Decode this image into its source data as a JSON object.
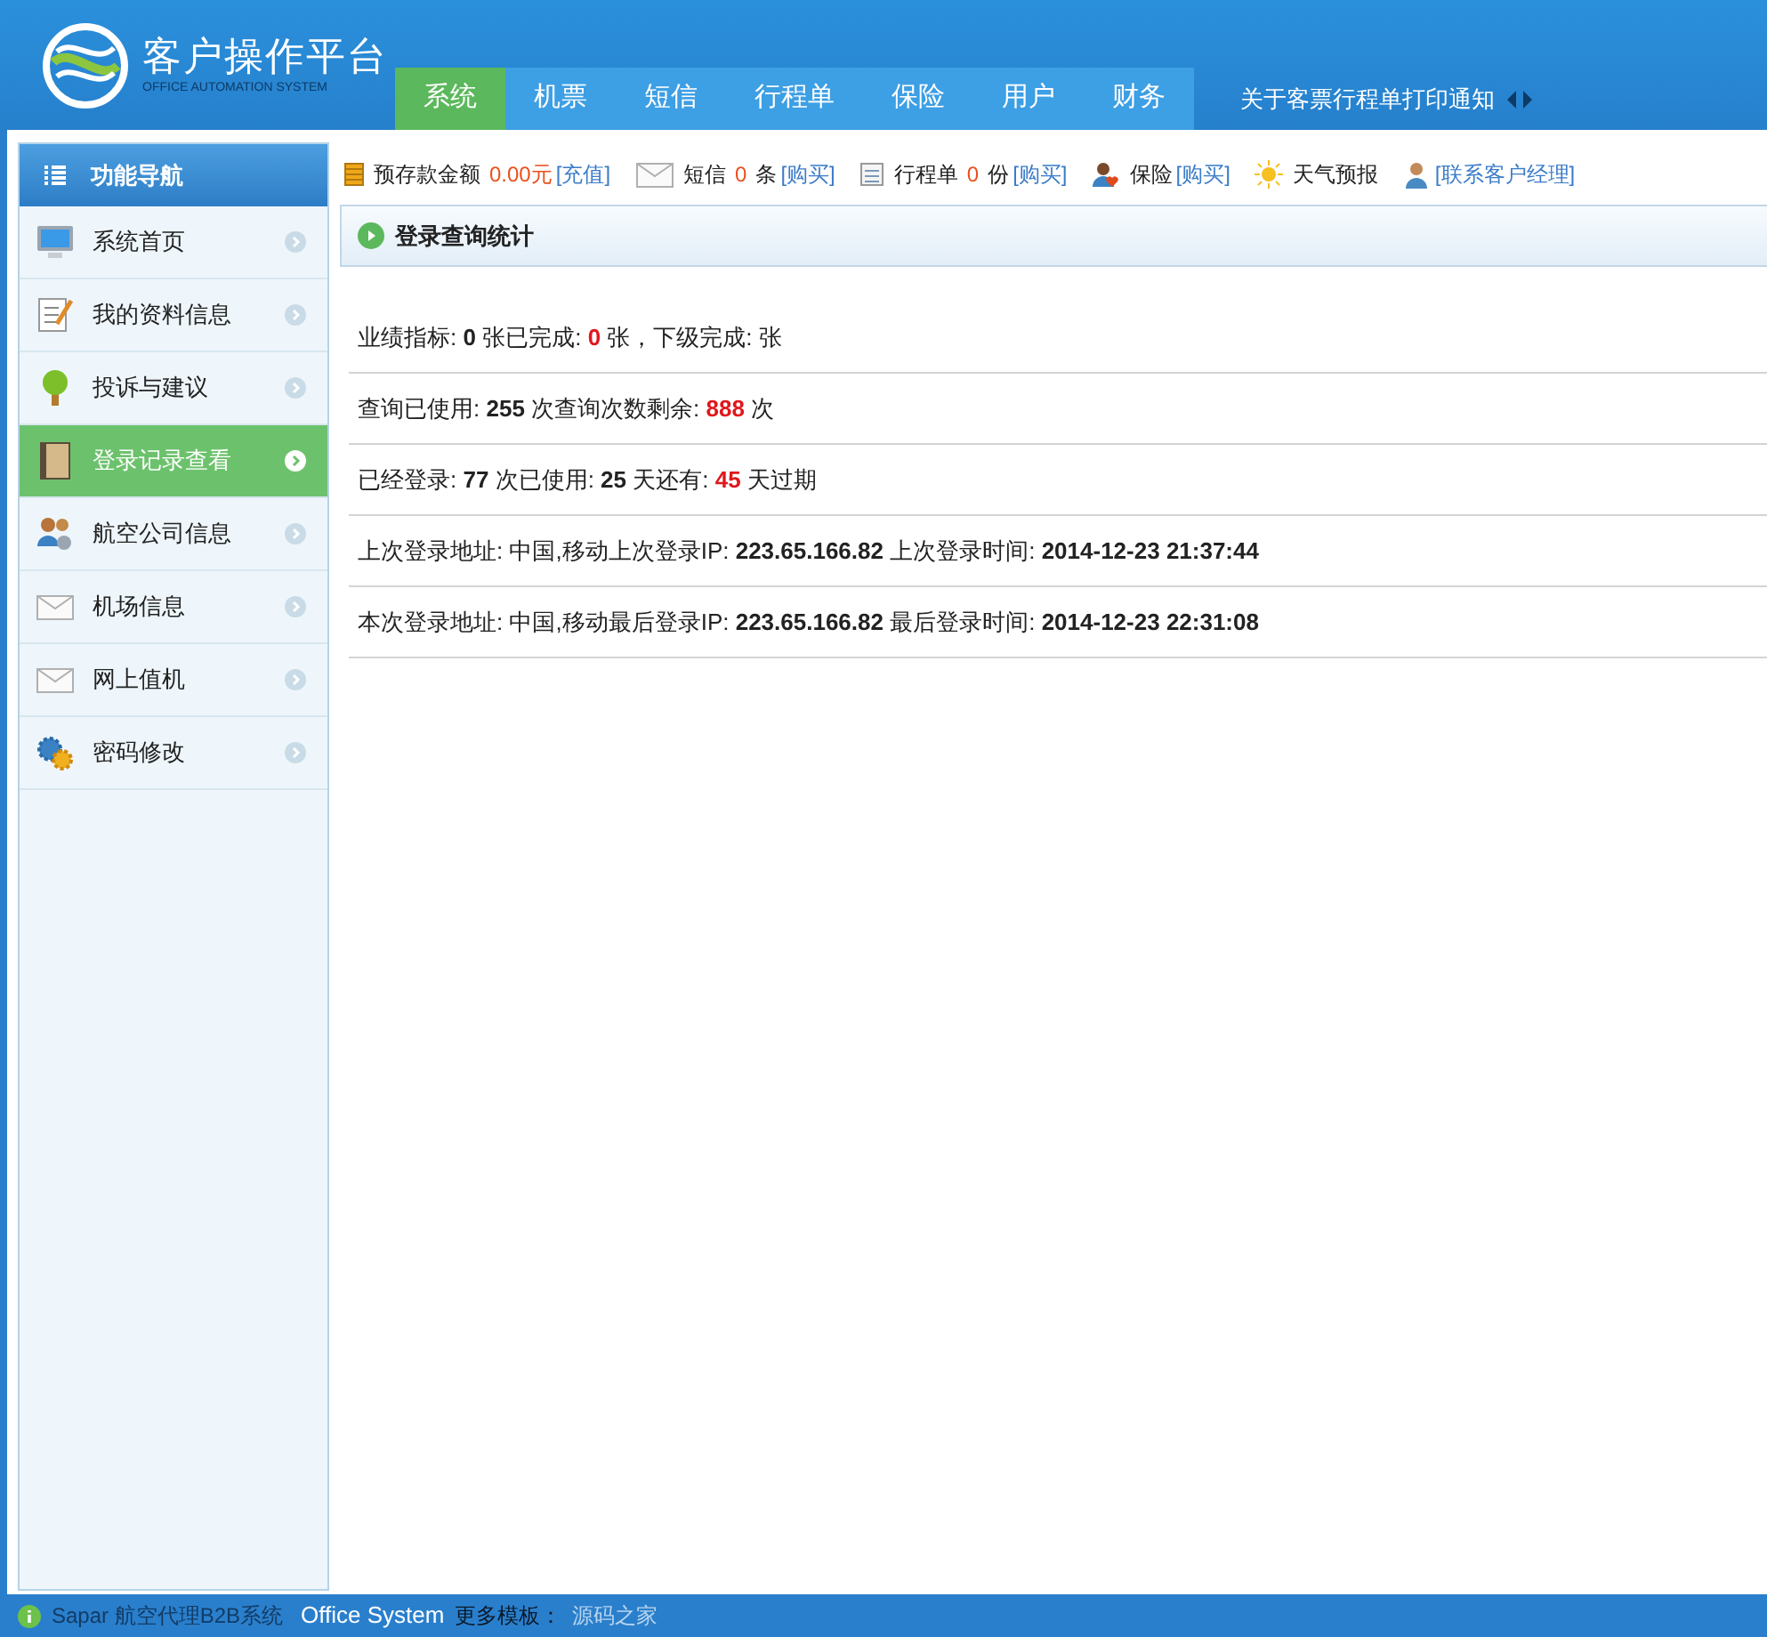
{
  "header": {
    "title": "客户操作平台",
    "subtitle": "OFFICE AUTOMATION SYSTEM"
  },
  "nav": {
    "tabs": [
      {
        "label": "系统",
        "selected": true
      },
      {
        "label": "机票",
        "selected": false
      },
      {
        "label": "短信",
        "selected": false
      },
      {
        "label": "行程单",
        "selected": false
      },
      {
        "label": "保险",
        "selected": false
      },
      {
        "label": "用户",
        "selected": false
      },
      {
        "label": "财务",
        "selected": false
      }
    ],
    "notice": "关于客票行程单打印通知"
  },
  "sidebar": {
    "title": "功能导航",
    "items": [
      {
        "label": "系统首页",
        "kind": "monitor",
        "selected": false
      },
      {
        "label": "我的资料信息",
        "kind": "notepad",
        "selected": false
      },
      {
        "label": "投诉与建议",
        "kind": "tree",
        "selected": false
      },
      {
        "label": "登录记录查看",
        "kind": "book",
        "selected": true
      },
      {
        "label": "航空公司信息",
        "kind": "people",
        "selected": false
      },
      {
        "label": "机场信息",
        "kind": "envelope",
        "selected": false
      },
      {
        "label": "网上值机",
        "kind": "envelope",
        "selected": false
      },
      {
        "label": "密码修改",
        "kind": "gears",
        "selected": false
      }
    ]
  },
  "toolbar": [
    {
      "kind": "coins",
      "label": "预存款金额",
      "value": "0.00元",
      "link": "[充值]"
    },
    {
      "kind": "envelope",
      "label": "短信",
      "value": "0",
      "unit": "条",
      "link": "[购买]"
    },
    {
      "kind": "document",
      "label": "行程单",
      "value": "0",
      "unit": "份",
      "link": "[购买]"
    },
    {
      "kind": "insurance",
      "label": "保险",
      "link": "[购买]"
    },
    {
      "kind": "sun",
      "label": "天气预报"
    },
    {
      "kind": "person",
      "link": "[联系客户经理]"
    }
  ],
  "panel": {
    "title": "登录查询统计",
    "lines": [
      [
        {
          "kind": "plain",
          "text": "业绩指标: "
        },
        {
          "kind": "bold",
          "text": "0"
        },
        {
          "kind": "plain",
          "text": " 张已完成: "
        },
        {
          "kind": "red",
          "text": "0"
        },
        {
          "kind": "plain",
          "text": " 张，下级完成: 张"
        }
      ],
      [
        {
          "kind": "plain",
          "text": "查询已使用: "
        },
        {
          "kind": "bold",
          "text": "255"
        },
        {
          "kind": "plain",
          "text": " 次查询次数剩余: "
        },
        {
          "kind": "red",
          "text": "888"
        },
        {
          "kind": "plain",
          "text": " 次"
        }
      ],
      [
        {
          "kind": "plain",
          "text": "已经登录: "
        },
        {
          "kind": "bold",
          "text": "77"
        },
        {
          "kind": "plain",
          "text": " 次已使用: "
        },
        {
          "kind": "bold",
          "text": "25"
        },
        {
          "kind": "plain",
          "text": " 天还有: "
        },
        {
          "kind": "red",
          "text": "45"
        },
        {
          "kind": "plain",
          "text": " 天过期"
        }
      ],
      [
        {
          "kind": "plain",
          "text": "上次登录地址: 中国,移动上次登录IP: "
        },
        {
          "kind": "bold",
          "text": "223.65.166.82"
        },
        {
          "kind": "plain",
          "text": " 上次登录时间: "
        },
        {
          "kind": "bold",
          "text": "2014-12-23 21:37:44"
        }
      ],
      [
        {
          "kind": "plain",
          "text": "本次登录地址: 中国,移动最后登录IP: "
        },
        {
          "kind": "bold",
          "text": "223.65.166.82"
        },
        {
          "kind": "plain",
          "text": " 最后登录时间: "
        },
        {
          "kind": "bold",
          "text": "2014-12-23 22:31:08"
        }
      ]
    ]
  },
  "footer": {
    "system": "Sapar 航空代理B2B系统",
    "product": "Office System",
    "more_label": "更多模板：",
    "more_link": "源码之家"
  }
}
